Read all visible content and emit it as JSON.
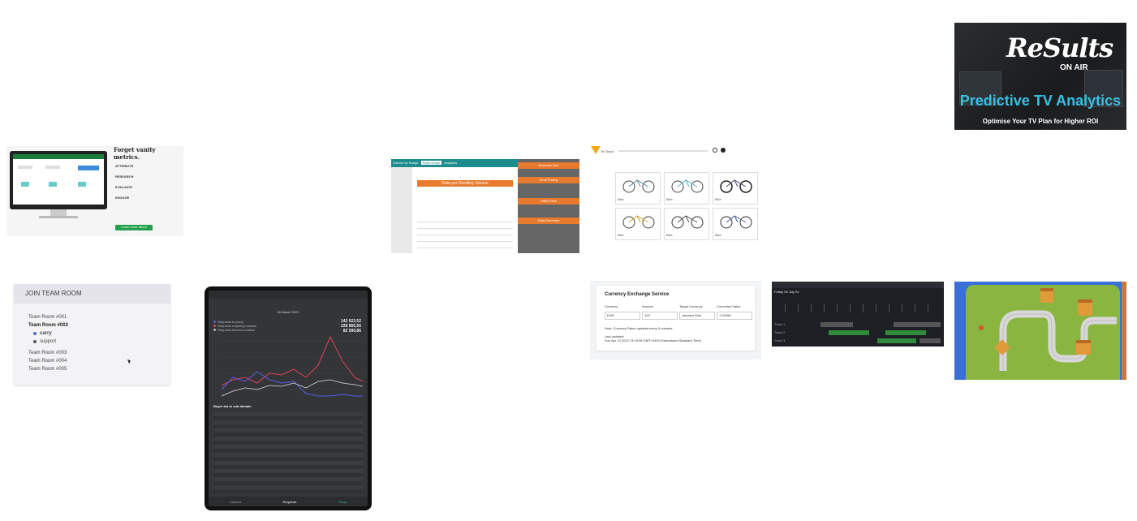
{
  "tv_analytics": {
    "logo_text": "ReSults",
    "on_air": "ON AIR",
    "title": "Predictive TV Analytics",
    "subtitle": "Optimise Your TV Plan for Higher ROI"
  },
  "vanity": {
    "heading": "Forget vanity metrics.",
    "features": [
      "ATTRIBUTE",
      "RESEARCH",
      "EVALUATE",
      "ENGAGE"
    ],
    "cta": "Learn more about Insights"
  },
  "dashboard": {
    "tabs": [
      "Volume by Range",
      "Ratio Graph",
      "Analytics"
    ],
    "panel_title": "Data per Dwelling Volume",
    "side_headers": [
      "Business Size",
      "Final Pricing",
      "Initial Fees",
      "Data Summary"
    ]
  },
  "bikes": {
    "brand": "To Cloud",
    "items": [
      "Bike",
      "Bike",
      "Bike",
      "Bike",
      "Bike",
      "Bike"
    ]
  },
  "team_room": {
    "header": "JOIN TEAM ROOM",
    "rooms": [
      "Team Room #001",
      "Team Room #002"
    ],
    "members": [
      "carry",
      "support"
    ],
    "rooms_after": [
      "Team Room #003",
      "Team Room #004",
      "Team Room #005"
    ]
  },
  "tablet": {
    "date": "16 March 2021",
    "legend": [
      "Requests to proxy",
      "Requests requiring rotation",
      "Requests blocked rotation"
    ],
    "totals": [
      "143 522,52",
      "228 866,56",
      "82 590,86"
    ],
    "table_title": "Buyer tea to sub domain",
    "tabs": [
      "Camera",
      "Requests",
      "Proxy"
    ],
    "colors": {
      "red": "#e0405a",
      "blue": "#5a5cf0",
      "gray": "#b8b8b8"
    }
  },
  "currency": {
    "title": "Currency Exchange Service",
    "labels": [
      "Currency",
      "Amount",
      "Target Currency",
      "Converted Value"
    ],
    "values": [
      "EUR",
      "100",
      "Jamaica Dolli",
      "1.23456"
    ],
    "note": "Note: Currency Rates updated every 5 minutes.",
    "last_updated_label": "Last updated:",
    "last_updated": "Sun Apr 10 2022 13:19:08 GMT+0400 (Samarkand Standard Time)"
  },
  "schedule": {
    "title": "Friday 05 July 2o",
    "tracks": [
      "Track 1",
      "Track 2",
      "Track 3"
    ]
  },
  "game": {
    "caption": ""
  }
}
